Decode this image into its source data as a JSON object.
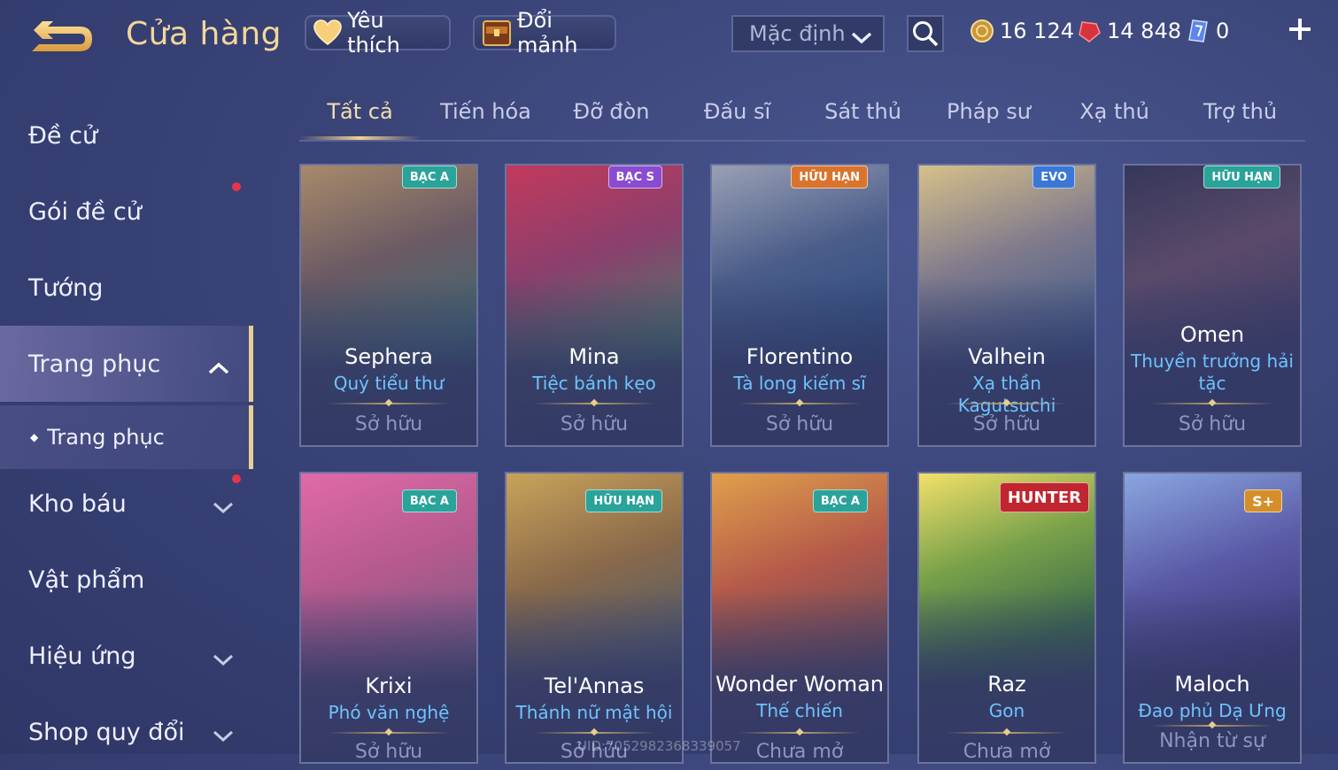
{
  "header": {
    "title": "Cửa hàng",
    "favorites_label": "Yêu thích",
    "exchange_label": "Đổi mảnh",
    "sort_value": "Mặc định",
    "currencies": [
      {
        "name": "gold",
        "icon": "gold-coin-icon",
        "value": "16 124"
      },
      {
        "name": "vouchers",
        "icon": "ruby-icon",
        "value": "14 848"
      },
      {
        "name": "crystals",
        "icon": "crystal-icon",
        "value": "0"
      }
    ]
  },
  "sidebar": {
    "items": [
      {
        "label": "Đề cử"
      },
      {
        "label": "Gói đề cử"
      },
      {
        "label": "Tướng"
      },
      {
        "label": "Trang phục"
      },
      {
        "label": "Trang phục"
      },
      {
        "label": "Kho báu"
      },
      {
        "label": "Vật phẩm"
      },
      {
        "label": "Hiệu ứng"
      },
      {
        "label": "Shop quy đổi"
      }
    ]
  },
  "tabs": [
    "Tất cả",
    "Tiến hóa",
    "Đỡ đòn",
    "Đấu sĩ",
    "Sát thủ",
    "Pháp sư",
    "Xạ thủ",
    "Trợ thủ"
  ],
  "cards": [
    {
      "hero": "Sephera",
      "skin": "Quý tiểu thư",
      "status": "Sở hữu",
      "badge": "BẠC A",
      "badge_color": "#2aa39a"
    },
    {
      "hero": "Mina",
      "skin": "Tiệc bánh kẹo",
      "status": "Sở hữu",
      "badge": "BẠC S",
      "badge_color": "#8a4bd0"
    },
    {
      "hero": "Florentino",
      "skin": "Tà long kiếm sĩ",
      "status": "Sở hữu",
      "badge": "HỮU HẠN",
      "badge_color": "#d9742e"
    },
    {
      "hero": "Valhein",
      "skin": "Xạ thần Kagutsuchi",
      "status": "Sở hữu",
      "badge": "EVO",
      "badge_color": "#3a77d6"
    },
    {
      "hero": "Omen",
      "skin": "Thuyền trưởng hải tặc",
      "status": "Sở hữu",
      "badge": "HỮU HẠN",
      "badge_color": "#2aa39a"
    },
    {
      "hero": "Krixi",
      "skin": "Phó văn nghệ",
      "status": "Sở hữu",
      "badge": "BẠC A",
      "badge_color": "#2aa39a"
    },
    {
      "hero": "Tel'Annas",
      "skin": "Thánh nữ mật hội",
      "status": "Sở hữu",
      "badge": "HỮU HẠN",
      "badge_color": "#2aa39a"
    },
    {
      "hero": "Wonder Woman",
      "skin": "Thế chiến",
      "status": "Chưa mở",
      "badge": "BẠC A",
      "badge_color": "#2aa39a"
    },
    {
      "hero": "Raz",
      "skin": "Gon",
      "status": "Chưa mở",
      "badge": "HUNTER",
      "badge_color": "#c0262f"
    },
    {
      "hero": "Maloch",
      "skin": "Đao phủ Dạ Ưng",
      "status": "Nhận từ sự",
      "badge": "S+",
      "badge_color": "#d58f2a"
    }
  ],
  "watermark": "UID:7052982368339057"
}
